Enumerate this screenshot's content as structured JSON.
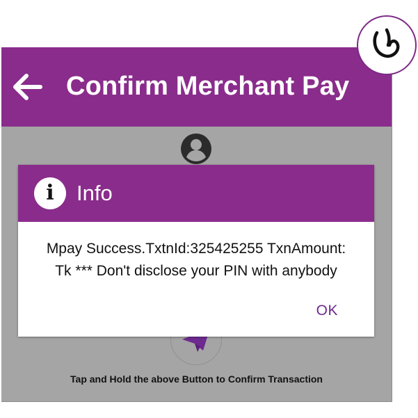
{
  "header": {
    "title": "Confirm Merchant Pay",
    "back_icon": "arrow-left-icon"
  },
  "screen": {
    "avatar_icon": "account-circle-icon",
    "send_icon": "send-icon",
    "hint": "Tap and Hold the above Button to Confirm Transaction"
  },
  "dialog": {
    "icon": "info-icon",
    "title": "Info",
    "message_line1": "Mpay Success.TxtnId:325425255 TxnAmount:",
    "message_line2": "Tk *** Don't disclose your PIN with anybody",
    "ok_label": "OK"
  },
  "colors": {
    "brand_purple": "#8a2c8c",
    "overlay_gray": "#a5a5a5",
    "ok_text": "#6d2a8f"
  }
}
